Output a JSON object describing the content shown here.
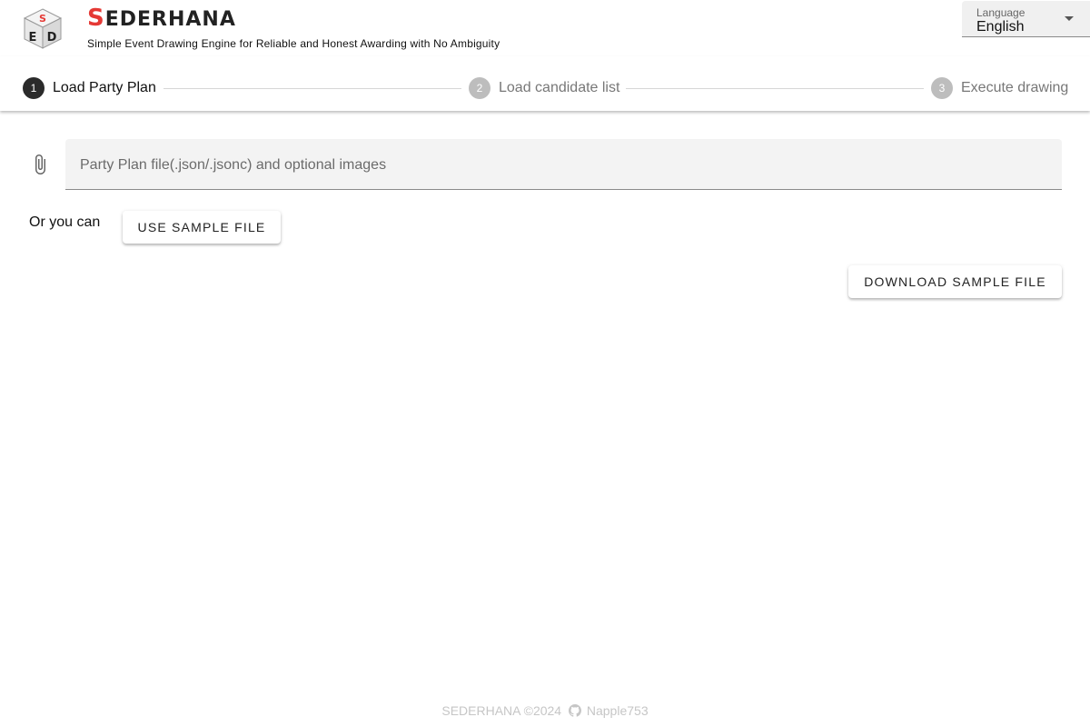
{
  "header": {
    "title_first": "S",
    "title_rest": "EDERHANA",
    "subtitle": "Simple Event Drawing Engine for Reliable and Honest Awarding with No Ambiguity",
    "logo_icon": "sed-cube-logo",
    "language": {
      "label": "Language",
      "value": "English"
    }
  },
  "stepper": {
    "steps": [
      {
        "number": "1",
        "label": "Load Party Plan",
        "active": true
      },
      {
        "number": "2",
        "label": "Load candidate list",
        "active": false
      },
      {
        "number": "3",
        "label": "Execute drawing",
        "active": false
      }
    ]
  },
  "main": {
    "file_input": {
      "placeholder": "Party Plan file(.json/.jsonc) and optional images",
      "icon": "paperclip-icon"
    },
    "or_text": "Or you can",
    "use_sample_label": "USE SAMPLE FILE",
    "download_sample_label": "DOWNLOAD SAMPLE FILE"
  },
  "footer": {
    "copyright": "SEDERHANA ©2024",
    "author": "Napple753",
    "icon": "github-icon"
  },
  "colors": {
    "accent": "#e53935",
    "active_step": "#2b2b2b",
    "inactive_step": "#bdbdbd"
  }
}
